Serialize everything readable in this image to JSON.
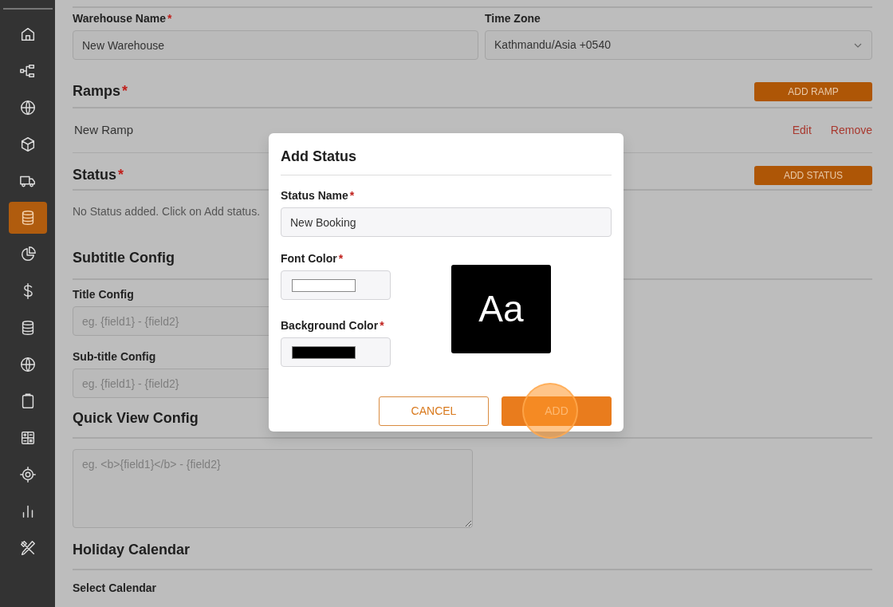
{
  "sidebar": {
    "items": [
      {
        "selected": false
      },
      {
        "selected": false
      },
      {
        "selected": false
      },
      {
        "selected": false
      },
      {
        "selected": false
      },
      {
        "selected": true
      },
      {
        "selected": false
      },
      {
        "selected": false
      },
      {
        "selected": false
      },
      {
        "selected": false
      },
      {
        "selected": false
      },
      {
        "selected": false
      },
      {
        "selected": false
      },
      {
        "selected": false
      },
      {
        "selected": false
      }
    ]
  },
  "form": {
    "warehouse_name": {
      "label": "Warehouse Name",
      "required_mark": "*",
      "value": "New Warehouse"
    },
    "time_zone": {
      "label": "Time Zone",
      "value": "Kathmandu/Asia +0540"
    },
    "ramps": {
      "title": "Ramps",
      "required_mark": "*",
      "button": "ADD RAMP",
      "rows": [
        {
          "name": "New Ramp",
          "edit": "Edit",
          "remove": "Remove"
        }
      ]
    },
    "status": {
      "title": "Status",
      "required_mark": "*",
      "button": "ADD STATUS",
      "empty_text": "No Status added. Click on Add status."
    },
    "subtitle_config": {
      "title": "Subtitle Config",
      "fields": [
        {
          "label": "Title Config",
          "placeholder": "eg. {field1} - {field2}"
        },
        {
          "label": "Sub-title Config",
          "placeholder": "eg. {field1} - {field2}"
        }
      ]
    },
    "quick_view_config": {
      "title": "Quick View Config",
      "placeholder": "eg. <b>{field1}</b> - {field2}"
    },
    "holiday_calendar": {
      "title": "Holiday Calendar",
      "label": "Select Calendar"
    }
  },
  "modal": {
    "title": "Add Status",
    "status_name": {
      "label": "Status Name",
      "required_mark": "*",
      "value": "New Booking"
    },
    "font_color": {
      "label": "Font Color",
      "required_mark": "*",
      "color": "#ffffff"
    },
    "background_color": {
      "label": "Background Color",
      "required_mark": "*",
      "color": "#000000"
    },
    "preview": "Aa",
    "buttons": [
      {
        "kind": "outline",
        "label": "CANCEL"
      },
      {
        "kind": "primary",
        "label": "ADD",
        "clicked": true
      }
    ]
  }
}
